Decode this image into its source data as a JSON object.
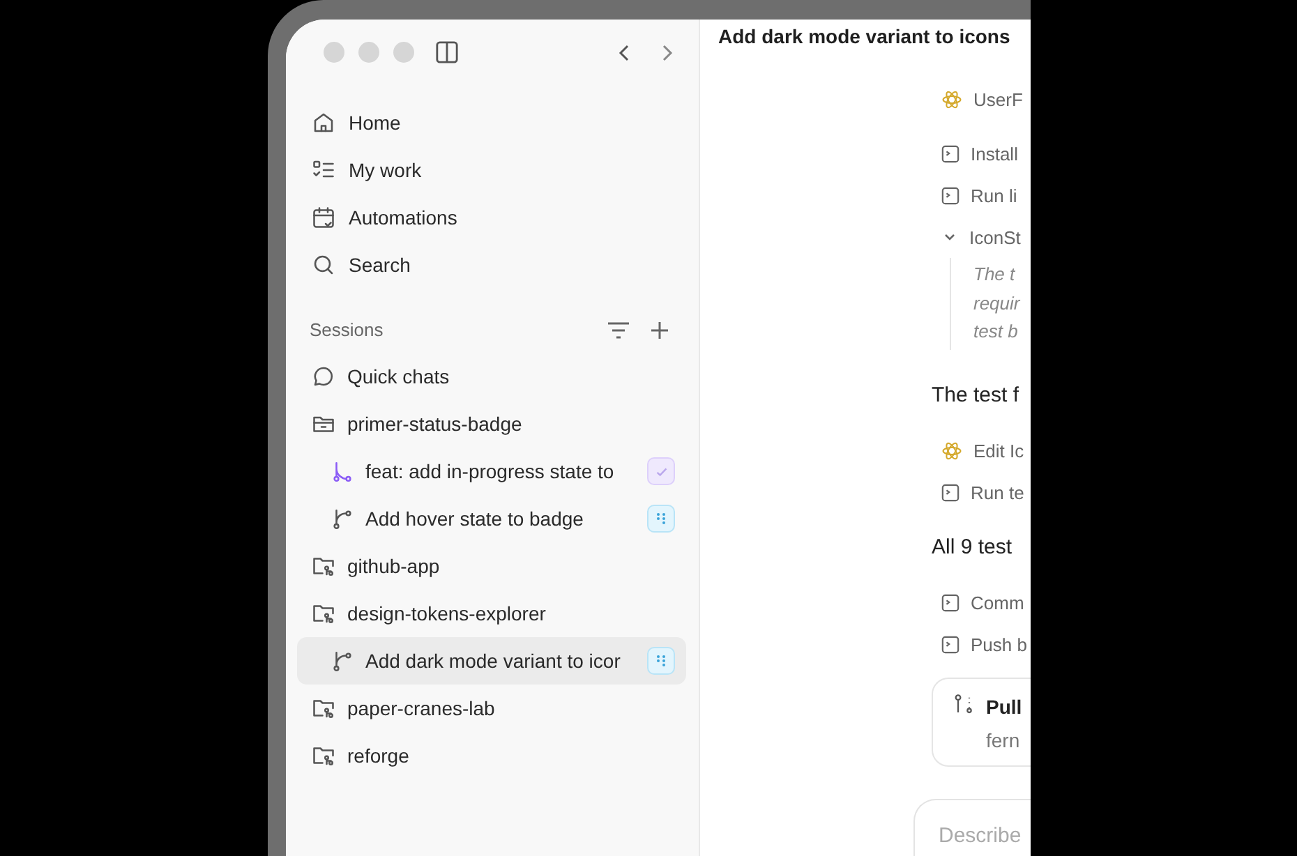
{
  "sidebar": {
    "nav": [
      {
        "kind": "home",
        "label": "Home"
      },
      {
        "kind": "work",
        "label": "My work"
      },
      {
        "kind": "calendar",
        "label": "Automations"
      },
      {
        "kind": "search",
        "label": "Search"
      }
    ],
    "sessions": {
      "heading": "Sessions",
      "items": [
        {
          "kind": "chat",
          "label": "Quick chats",
          "selected": false
        },
        {
          "kind": "workspace",
          "label": "primer-status-badge",
          "selected": false,
          "children": [
            {
              "kind": "merged",
              "label": "feat: add in-progress state to",
              "selected": false
            },
            {
              "kind": "active",
              "label": "Add hover state to badge",
              "selected": false
            }
          ]
        },
        {
          "kind": "repo",
          "label": "github-app",
          "selected": false
        },
        {
          "kind": "repo",
          "label": "design-tokens-explorer",
          "selected": false,
          "children": [
            {
              "kind": "active",
              "label": "Add dark mode variant to icor",
              "selected": true
            }
          ]
        },
        {
          "kind": "repo",
          "label": "paper-cranes-lab",
          "selected": false
        },
        {
          "kind": "repo",
          "label": "reforge",
          "selected": false
        }
      ]
    }
  },
  "main": {
    "title": "Add dark mode variant to icons",
    "feed": [
      {
        "kind": "edit",
        "text": "UserF"
      },
      {
        "kind": "tool",
        "text": "Install"
      },
      {
        "kind": "tool",
        "text": "Run li"
      },
      {
        "kind": "thinking",
        "text": "IconSt",
        "expanded": true,
        "lines": [
          "The t",
          "requir",
          "test b"
        ]
      },
      {
        "kind": "message",
        "text": "The test f"
      },
      {
        "kind": "edit",
        "text": "Edit Ic"
      },
      {
        "kind": "tool",
        "text": "Run te"
      },
      {
        "kind": "message",
        "text": "All 9 test"
      },
      {
        "kind": "tool",
        "text": "Comm"
      },
      {
        "kind": "tool",
        "text": "Push b"
      },
      {
        "kind": "pr",
        "title": "Pull",
        "subtitle": "fern"
      }
    ],
    "composer": {
      "placeholder": "Describe"
    }
  }
}
